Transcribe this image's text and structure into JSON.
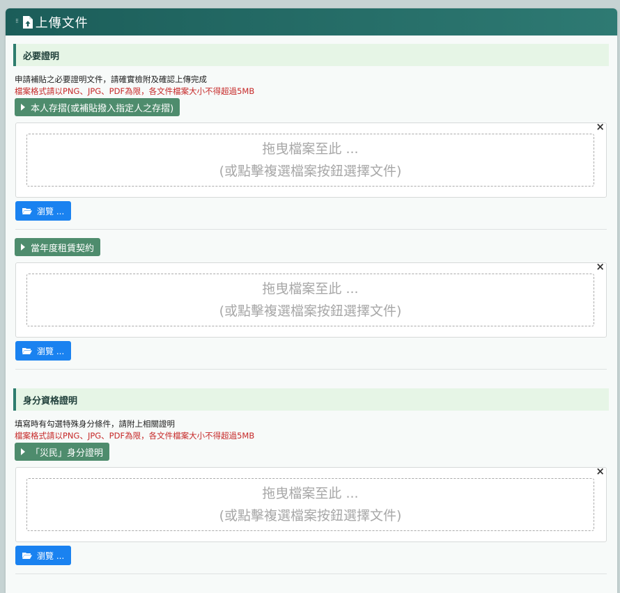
{
  "panel": {
    "title": "上傳文件",
    "icons": {
      "grip": "drag-grip-icon",
      "file": "file-upload-icon"
    }
  },
  "sections": [
    {
      "title": "必要證明",
      "description": "申請補貼之必要證明文件，請確實檢附及確認上傳完成",
      "warning": "檔案格式請以PNG、JPG、PDF為限，各文件檔案大小不得超過5MB",
      "uploads": [
        {
          "label": "本人存摺(或補貼撥入指定人之存摺)",
          "drop_line1": "拖曳檔案至此 ...",
          "drop_line2": "(或點擊複選檔案按鈕選擇文件)",
          "close": "×",
          "browse": "瀏覽 ..."
        },
        {
          "label": "當年度租賃契約",
          "drop_line1": "拖曳檔案至此 ...",
          "drop_line2": "(或點擊複選檔案按鈕選擇文件)",
          "close": "×",
          "browse": "瀏覽 ..."
        }
      ]
    },
    {
      "title": "身分資格證明",
      "description": "填寫時有勾選特殊身分條件，請附上相關證明",
      "warning": "檔案格式請以PNG、JPG、PDF為限，各文件檔案大小不得超過5MB",
      "uploads": [
        {
          "label": "「災民」身分證明",
          "drop_line1": "拖曳檔案至此 ...",
          "drop_line2": "(或點擊複選檔案按鈕選擇文件)",
          "close": "×",
          "browse": "瀏覽 ..."
        }
      ]
    }
  ],
  "colors": {
    "header": "#1b5d59",
    "section_bar": "#e6f5e6",
    "toggle": "#4e8c6d",
    "browse": "#1a82f0",
    "warning": "#c62828"
  }
}
